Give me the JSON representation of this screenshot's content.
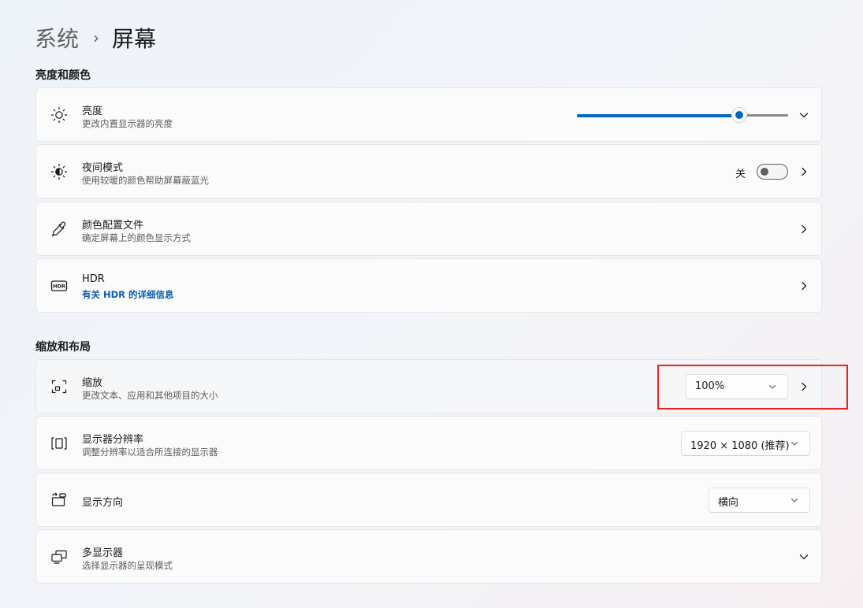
{
  "breadcrumb": {
    "parent": "系统",
    "separator": "›",
    "current": "屏幕"
  },
  "sections": {
    "brightness_color": "亮度和颜色",
    "scale_layout": "缩放和布局"
  },
  "brightness": {
    "title": "亮度",
    "subtitle": "更改内置显示器的亮度",
    "value_percent": 77,
    "icon": "sun-icon"
  },
  "night_light": {
    "title": "夜间模式",
    "subtitle": "使用较暖的颜色帮助屏幕蔽蓝光",
    "state_label": "关",
    "enabled": false,
    "icon": "night-light-icon"
  },
  "color_profile": {
    "title": "颜色配置文件",
    "subtitle": "确定屏幕上的颜色显示方式",
    "icon": "eyedropper-icon"
  },
  "hdr": {
    "title": "HDR",
    "link": "有关 HDR 的详细信息",
    "icon": "hdr-icon"
  },
  "scale": {
    "title": "缩放",
    "subtitle": "更改文本、应用和其他项目的大小",
    "value": "100%",
    "icon": "scale-icon"
  },
  "resolution": {
    "title": "显示器分辨率",
    "subtitle": "调整分辨率以适合所连接的显示器",
    "value": "1920 × 1080 (推荐)",
    "icon": "resolution-icon"
  },
  "orientation": {
    "title": "显示方向",
    "value": "横向",
    "icon": "orientation-icon"
  },
  "multi_display": {
    "title": "多显示器",
    "subtitle": "选择显示器的呈现模式",
    "icon": "multi-display-icon"
  },
  "colors": {
    "accent": "#0067c0",
    "highlight": "#e8231f",
    "link": "#0b5cad"
  }
}
